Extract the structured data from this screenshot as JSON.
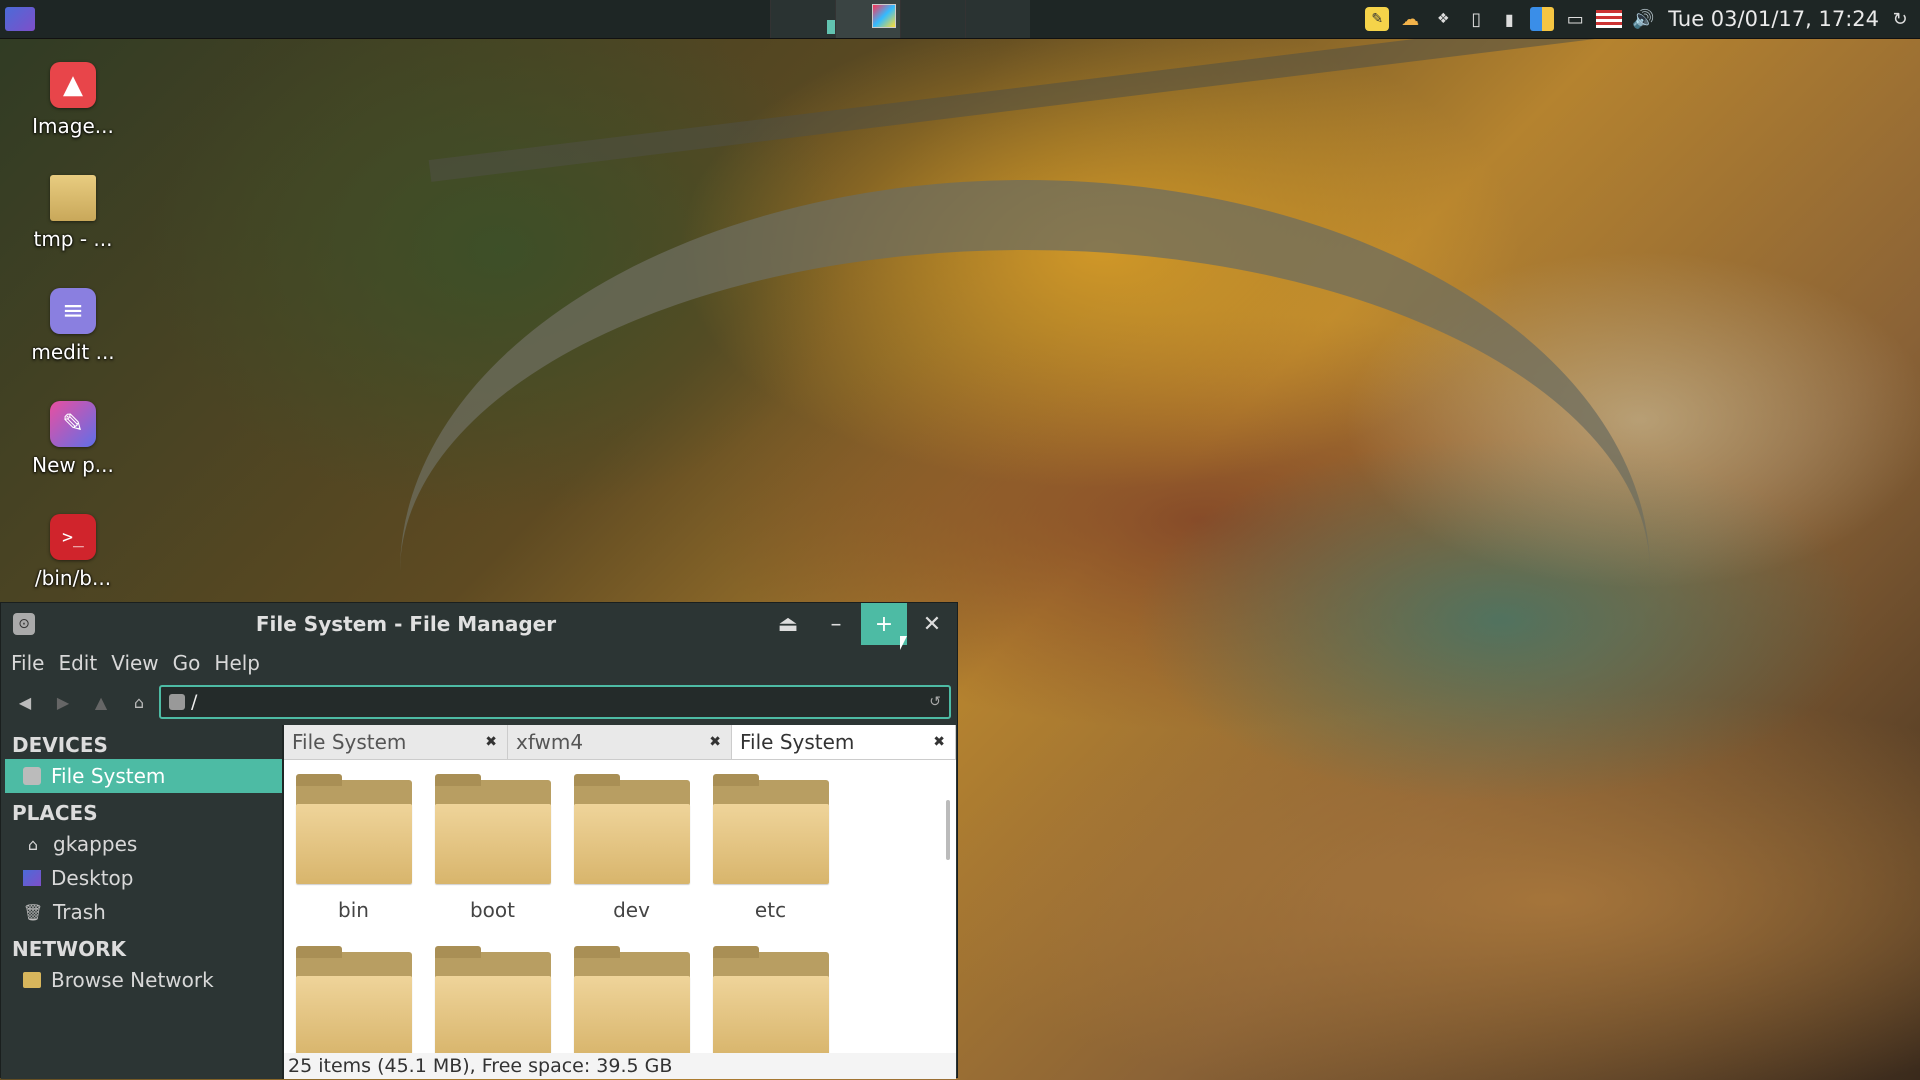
{
  "panel": {
    "clock": "Tue 03/01/17, 17:24",
    "tray_icons": [
      "notes-icon",
      "weather-icon",
      "dropbox-icon",
      "clipboard-icon",
      "network-signal-icon",
      "color-icon",
      "battery-icon",
      "us-flag-icon",
      "volume-icon"
    ],
    "refresh_icon": "refresh-icon"
  },
  "desktop": {
    "icons": [
      {
        "label": "Image...",
        "color": "#e8454a",
        "glyph": "▲"
      },
      {
        "label": "tmp - ...",
        "color": "#d8b65c",
        "glyph": ""
      },
      {
        "label": "medit ...",
        "color": "#8a7fe0",
        "glyph": "≡"
      },
      {
        "label": "New p...",
        "color": "#c04fd0",
        "glyph": "✎"
      },
      {
        "label": "/bin/b...",
        "color": "#d0242c",
        "glyph": ">_"
      }
    ]
  },
  "window": {
    "title": "File System - File Manager",
    "menu": [
      "File",
      "Edit",
      "View",
      "Go",
      "Help"
    ],
    "location": "/",
    "sidebar": {
      "devices_heading": "DEVICES",
      "devices": [
        {
          "label": "File System",
          "selected": true
        }
      ],
      "places_heading": "PLACES",
      "places": [
        {
          "label": "gkappes",
          "icon": "home-icon"
        },
        {
          "label": "Desktop",
          "icon": "desktop-icon"
        },
        {
          "label": "Trash",
          "icon": "trash-icon"
        }
      ],
      "network_heading": "NETWORK",
      "network": [
        {
          "label": "Browse Network",
          "icon": "network-icon"
        }
      ]
    },
    "tabs": [
      {
        "label": "File System",
        "active": false
      },
      {
        "label": "xfwm4",
        "active": false
      },
      {
        "label": "File System",
        "active": true
      }
    ],
    "folders": [
      "bin",
      "boot",
      "dev",
      "etc",
      "",
      "",
      "",
      ""
    ],
    "status": "25 items (45.1 MB), Free space: 39.5 GB"
  },
  "colors": {
    "accent": "#4dbba4",
    "window_bg": "#2c3534",
    "panel_bg": "#1e2625"
  }
}
